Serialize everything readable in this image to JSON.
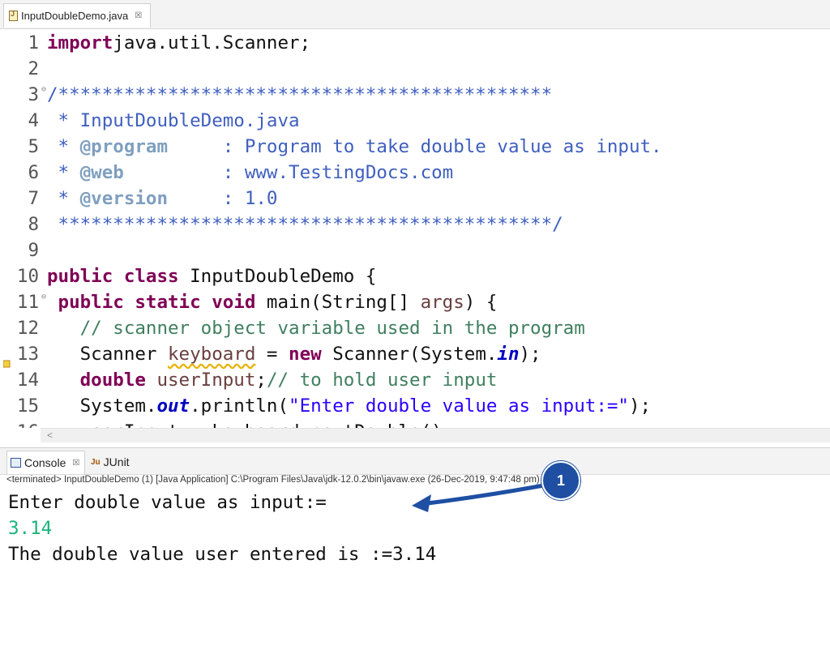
{
  "editor_tab": {
    "title": "InputDoubleDemo.java",
    "close": "☒"
  },
  "code": {
    "lines": [
      {
        "n": "1",
        "parts": [
          [
            "kw",
            "import"
          ],
          [
            "",
            "java.util.Scanner;"
          ]
        ]
      },
      {
        "n": "2",
        "parts": []
      },
      {
        "n": "3",
        "fold": true,
        "parts": [
          [
            "cm",
            "/*********************************************"
          ]
        ]
      },
      {
        "n": "4",
        "parts": [
          [
            "cm",
            " * InputDoubleDemo.java"
          ]
        ]
      },
      {
        "n": "5",
        "parts": [
          [
            "cm",
            " * "
          ],
          [
            "tag",
            "@program"
          ],
          [
            "cm",
            "     : Program to take double value as input."
          ]
        ]
      },
      {
        "n": "6",
        "parts": [
          [
            "cm",
            " * "
          ],
          [
            "tag",
            "@web"
          ],
          [
            "cm",
            "         : www.TestingDocs.com"
          ]
        ]
      },
      {
        "n": "7",
        "parts": [
          [
            "cm",
            " * "
          ],
          [
            "tag",
            "@version"
          ],
          [
            "cm",
            "     : 1.0"
          ]
        ]
      },
      {
        "n": "8",
        "parts": [
          [
            "cm",
            " *********************************************/"
          ]
        ]
      },
      {
        "n": "9",
        "parts": []
      },
      {
        "n": "10",
        "parts": [
          [
            "kw",
            "public"
          ],
          [
            "",
            " "
          ],
          [
            "kw",
            "class"
          ],
          [
            "",
            " InputDoubleDemo {"
          ]
        ]
      },
      {
        "n": "11",
        "fold": true,
        "parts": [
          [
            "",
            " "
          ],
          [
            "kw",
            "public"
          ],
          [
            "",
            " "
          ],
          [
            "kw",
            "static"
          ],
          [
            "",
            " "
          ],
          [
            "kw",
            "void"
          ],
          [
            "",
            " main(String[] "
          ],
          [
            "var",
            "args"
          ],
          [
            "",
            ") {"
          ]
        ]
      },
      {
        "n": "12",
        "parts": [
          [
            "",
            "   "
          ],
          [
            "lc",
            "// scanner object variable used in the program"
          ]
        ]
      },
      {
        "n": "13",
        "marker": true,
        "parts": [
          [
            "",
            "   Scanner "
          ],
          [
            "var warn-underline",
            "keyboard"
          ],
          [
            "",
            " = "
          ],
          [
            "kw",
            "new"
          ],
          [
            "",
            " Scanner(System."
          ],
          [
            "fld",
            "in"
          ],
          [
            "",
            ");"
          ]
        ]
      },
      {
        "n": "14",
        "parts": [
          [
            "",
            "   "
          ],
          [
            "kw",
            "double"
          ],
          [
            "",
            " "
          ],
          [
            "var",
            "userInput"
          ],
          [
            "",
            ";"
          ],
          [
            "lc",
            "// to hold user input"
          ]
        ]
      },
      {
        "n": "15",
        "parts": [
          [
            "",
            "   System."
          ],
          [
            "fld",
            "out"
          ],
          [
            "",
            ".println("
          ],
          [
            "str",
            "\"Enter double value as input:=\""
          ],
          [
            "",
            ");"
          ]
        ]
      },
      {
        "n": "16",
        "parts": [
          [
            "",
            "   userInput = keyboard.nextDouble();"
          ]
        ]
      }
    ]
  },
  "console": {
    "tab_console": "Console",
    "tab_console_close": "☒",
    "tab_junit": "JUnit",
    "junit_glyph": "Ju",
    "status": "<terminated> InputDoubleDemo (1) [Java Application] C:\\Program Files\\Java\\jdk-12.0.2\\bin\\javaw.exe (26-Dec-2019, 9:47:48 pm)",
    "output": [
      {
        "text": "Enter double value as input:=",
        "kind": "out"
      },
      {
        "text": "3.14",
        "kind": "input"
      },
      {
        "text": "The double value user entered is :=3.14",
        "kind": "out"
      }
    ]
  },
  "callout": {
    "number": "1",
    "color": "#1e4fa3"
  },
  "scroll_left": "<"
}
